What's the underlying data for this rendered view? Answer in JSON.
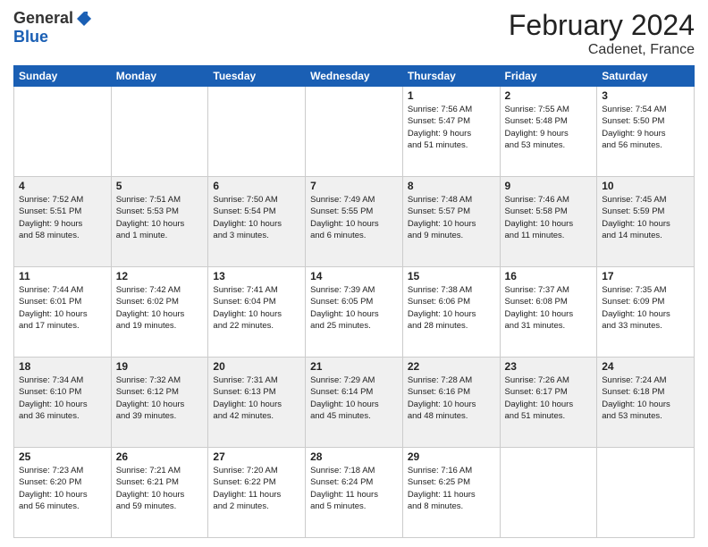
{
  "header": {
    "logo_general": "General",
    "logo_blue": "Blue",
    "title": "February 2024",
    "location": "Cadenet, France"
  },
  "days_of_week": [
    "Sunday",
    "Monday",
    "Tuesday",
    "Wednesday",
    "Thursday",
    "Friday",
    "Saturday"
  ],
  "weeks": [
    [
      {
        "day": "",
        "info": ""
      },
      {
        "day": "",
        "info": ""
      },
      {
        "day": "",
        "info": ""
      },
      {
        "day": "",
        "info": ""
      },
      {
        "day": "1",
        "info": "Sunrise: 7:56 AM\nSunset: 5:47 PM\nDaylight: 9 hours\nand 51 minutes."
      },
      {
        "day": "2",
        "info": "Sunrise: 7:55 AM\nSunset: 5:48 PM\nDaylight: 9 hours\nand 53 minutes."
      },
      {
        "day": "3",
        "info": "Sunrise: 7:54 AM\nSunset: 5:50 PM\nDaylight: 9 hours\nand 56 minutes."
      }
    ],
    [
      {
        "day": "4",
        "info": "Sunrise: 7:52 AM\nSunset: 5:51 PM\nDaylight: 9 hours\nand 58 minutes."
      },
      {
        "day": "5",
        "info": "Sunrise: 7:51 AM\nSunset: 5:53 PM\nDaylight: 10 hours\nand 1 minute."
      },
      {
        "day": "6",
        "info": "Sunrise: 7:50 AM\nSunset: 5:54 PM\nDaylight: 10 hours\nand 3 minutes."
      },
      {
        "day": "7",
        "info": "Sunrise: 7:49 AM\nSunset: 5:55 PM\nDaylight: 10 hours\nand 6 minutes."
      },
      {
        "day": "8",
        "info": "Sunrise: 7:48 AM\nSunset: 5:57 PM\nDaylight: 10 hours\nand 9 minutes."
      },
      {
        "day": "9",
        "info": "Sunrise: 7:46 AM\nSunset: 5:58 PM\nDaylight: 10 hours\nand 11 minutes."
      },
      {
        "day": "10",
        "info": "Sunrise: 7:45 AM\nSunset: 5:59 PM\nDaylight: 10 hours\nand 14 minutes."
      }
    ],
    [
      {
        "day": "11",
        "info": "Sunrise: 7:44 AM\nSunset: 6:01 PM\nDaylight: 10 hours\nand 17 minutes."
      },
      {
        "day": "12",
        "info": "Sunrise: 7:42 AM\nSunset: 6:02 PM\nDaylight: 10 hours\nand 19 minutes."
      },
      {
        "day": "13",
        "info": "Sunrise: 7:41 AM\nSunset: 6:04 PM\nDaylight: 10 hours\nand 22 minutes."
      },
      {
        "day": "14",
        "info": "Sunrise: 7:39 AM\nSunset: 6:05 PM\nDaylight: 10 hours\nand 25 minutes."
      },
      {
        "day": "15",
        "info": "Sunrise: 7:38 AM\nSunset: 6:06 PM\nDaylight: 10 hours\nand 28 minutes."
      },
      {
        "day": "16",
        "info": "Sunrise: 7:37 AM\nSunset: 6:08 PM\nDaylight: 10 hours\nand 31 minutes."
      },
      {
        "day": "17",
        "info": "Sunrise: 7:35 AM\nSunset: 6:09 PM\nDaylight: 10 hours\nand 33 minutes."
      }
    ],
    [
      {
        "day": "18",
        "info": "Sunrise: 7:34 AM\nSunset: 6:10 PM\nDaylight: 10 hours\nand 36 minutes."
      },
      {
        "day": "19",
        "info": "Sunrise: 7:32 AM\nSunset: 6:12 PM\nDaylight: 10 hours\nand 39 minutes."
      },
      {
        "day": "20",
        "info": "Sunrise: 7:31 AM\nSunset: 6:13 PM\nDaylight: 10 hours\nand 42 minutes."
      },
      {
        "day": "21",
        "info": "Sunrise: 7:29 AM\nSunset: 6:14 PM\nDaylight: 10 hours\nand 45 minutes."
      },
      {
        "day": "22",
        "info": "Sunrise: 7:28 AM\nSunset: 6:16 PM\nDaylight: 10 hours\nand 48 minutes."
      },
      {
        "day": "23",
        "info": "Sunrise: 7:26 AM\nSunset: 6:17 PM\nDaylight: 10 hours\nand 51 minutes."
      },
      {
        "day": "24",
        "info": "Sunrise: 7:24 AM\nSunset: 6:18 PM\nDaylight: 10 hours\nand 53 minutes."
      }
    ],
    [
      {
        "day": "25",
        "info": "Sunrise: 7:23 AM\nSunset: 6:20 PM\nDaylight: 10 hours\nand 56 minutes."
      },
      {
        "day": "26",
        "info": "Sunrise: 7:21 AM\nSunset: 6:21 PM\nDaylight: 10 hours\nand 59 minutes."
      },
      {
        "day": "27",
        "info": "Sunrise: 7:20 AM\nSunset: 6:22 PM\nDaylight: 11 hours\nand 2 minutes."
      },
      {
        "day": "28",
        "info": "Sunrise: 7:18 AM\nSunset: 6:24 PM\nDaylight: 11 hours\nand 5 minutes."
      },
      {
        "day": "29",
        "info": "Sunrise: 7:16 AM\nSunset: 6:25 PM\nDaylight: 11 hours\nand 8 minutes."
      },
      {
        "day": "",
        "info": ""
      },
      {
        "day": "",
        "info": ""
      }
    ]
  ]
}
